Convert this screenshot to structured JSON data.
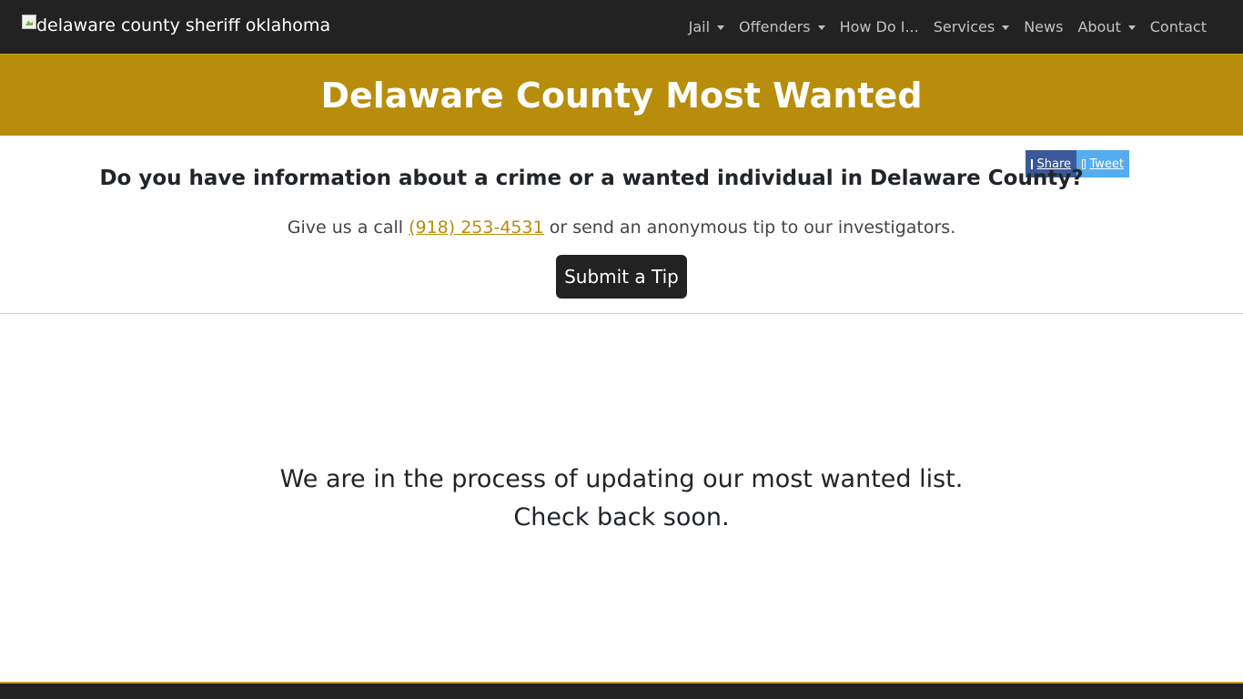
{
  "navbar": {
    "brand_alt": "delaware county sheriff oklahoma",
    "items": [
      {
        "label": "Jail",
        "dropdown": true
      },
      {
        "label": "Offenders",
        "dropdown": true
      },
      {
        "label": "How Do I...",
        "dropdown": false
      },
      {
        "label": "Services",
        "dropdown": true
      },
      {
        "label": "News",
        "dropdown": false
      },
      {
        "label": "About",
        "dropdown": true
      },
      {
        "label": "Contact",
        "dropdown": false
      }
    ]
  },
  "hero": {
    "title": "Delaware County Most Wanted"
  },
  "share": {
    "facebook_label": "Share",
    "twitter_label": "Tweet"
  },
  "tip_section": {
    "question": "Do you have information about a crime or a wanted individual in Delaware County?",
    "call_prefix": "Give us a call ",
    "phone": "(918) 253-4531",
    "call_suffix": " or send an anonymous tip to our investigators.",
    "button_label": "Submit a Tip"
  },
  "status": {
    "line1": "We are in the process of updating our most wanted list.",
    "line2": "Check back soon."
  },
  "colors": {
    "nav_bg": "#222222",
    "hero_bg": "#b88d0b",
    "accent": "#c9a227",
    "facebook": "#3b5998",
    "twitter": "#55acee"
  }
}
